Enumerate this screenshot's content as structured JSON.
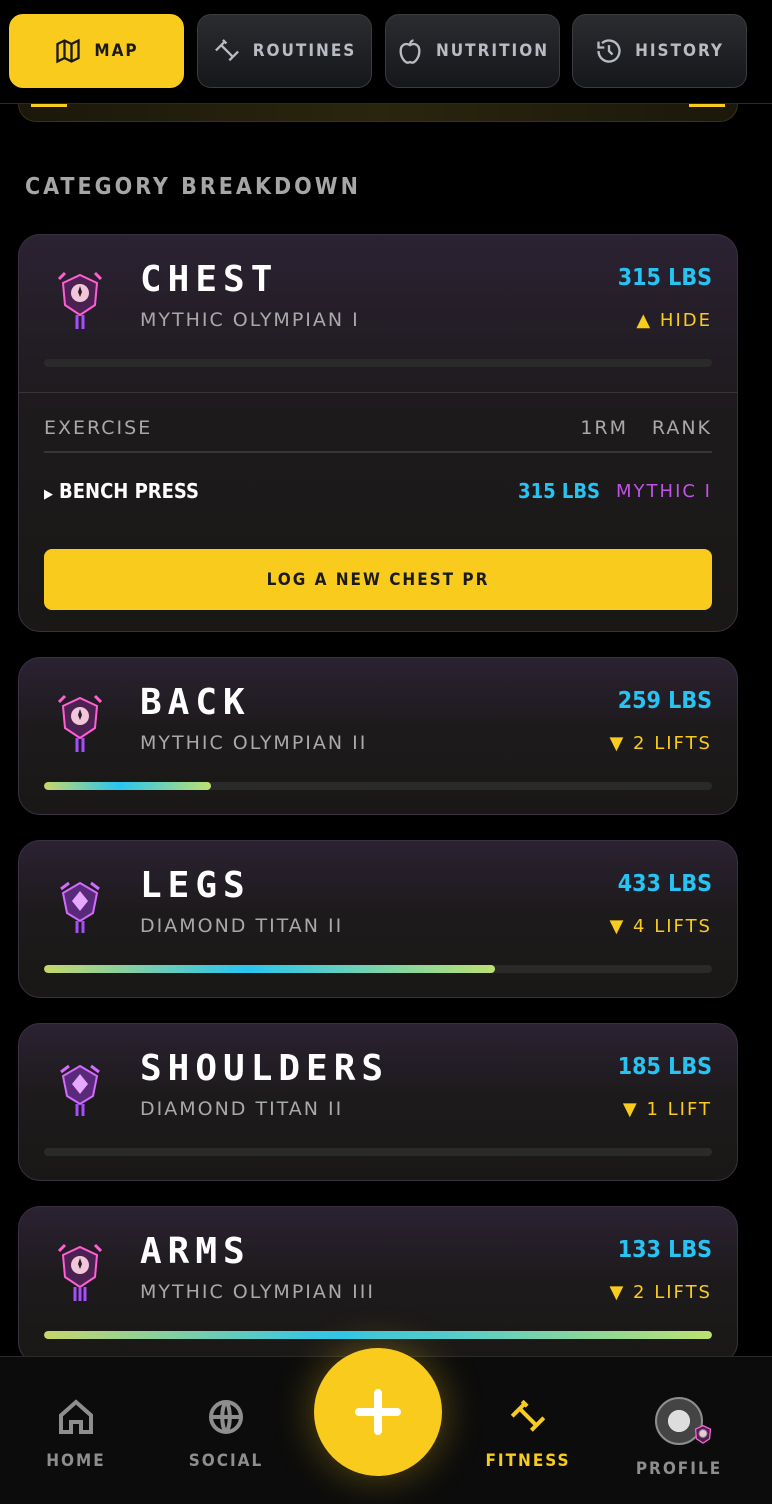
{
  "tabs": [
    {
      "label": "MAP",
      "icon": "map-icon",
      "active": true
    },
    {
      "label": "ROUTINES",
      "icon": "dumbbell-icon",
      "active": false
    },
    {
      "label": "NUTRITION",
      "icon": "apple-icon",
      "active": false
    },
    {
      "label": "HISTORY",
      "icon": "history-icon",
      "active": false
    }
  ],
  "section_title": "CATEGORY BREAKDOWN",
  "categories": [
    {
      "name": "CHEST",
      "tier": "MYTHIC OLYMPIAN I",
      "weight": "315 LBS",
      "toggle": "▲ HIDE",
      "progress": 0,
      "badge": "mythic-badge-icon",
      "exercise_header": {
        "exercise": "EXERCISE",
        "one_rm": "1RM",
        "rank": "RANK"
      },
      "exercises": [
        {
          "name": "BENCH PRESS",
          "one_rm": "315 LBS",
          "rank": "MYTHIC I"
        }
      ],
      "log_button": "LOG A NEW CHEST PR"
    },
    {
      "name": "BACK",
      "tier": "MYTHIC OLYMPIAN II",
      "weight": "259 LBS",
      "toggle": "▼ 2 LIFTS",
      "progress": 0.25,
      "badge": "mythic-badge-icon"
    },
    {
      "name": "LEGS",
      "tier": "DIAMOND TITAN II",
      "weight": "433 LBS",
      "toggle": "▼ 4 LIFTS",
      "progress": 0.675,
      "badge": "diamond-badge-icon"
    },
    {
      "name": "SHOULDERS",
      "tier": "DIAMOND TITAN II",
      "weight": "185 LBS",
      "toggle": "▼ 1 LIFT",
      "progress": 0,
      "badge": "diamond-badge-icon"
    },
    {
      "name": "ARMS",
      "tier": "MYTHIC OLYMPIAN III",
      "weight": "133 LBS",
      "toggle": "▼ 2 LIFTS",
      "progress": 1.0,
      "badge": "mythic-badge-icon"
    }
  ],
  "bottom_nav": [
    {
      "label": "HOME",
      "icon": "home-icon",
      "active": false
    },
    {
      "label": "SOCIAL",
      "icon": "globe-icon",
      "active": false
    },
    {
      "label": "FITNESS",
      "icon": "dumbbell-icon",
      "active": true
    },
    {
      "label": "PROFILE",
      "icon": "avatar",
      "active": false
    }
  ],
  "colors": {
    "accent": "#f9cb1c",
    "weight": "#27c3f2",
    "rank_mythic": "#c052e6",
    "background": "#000000"
  }
}
